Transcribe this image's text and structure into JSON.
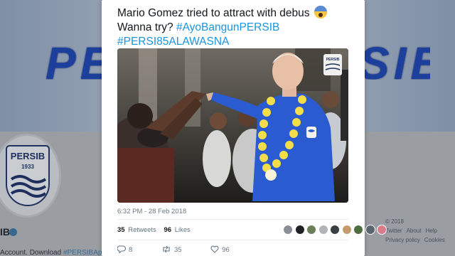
{
  "background": {
    "banner_word_left": "PERS",
    "banner_word_right": "SIB",
    "crest": {
      "name": "PERSIB",
      "year": "1933"
    },
    "profile_name_fragment": "IB",
    "bio_prefix": "Account. Download ",
    "bio_hashtag": "#PERSIBApps",
    "footer": {
      "copyright": "© 2018 Twitter",
      "about": "About",
      "help": "Help",
      "privacy": "Privacy policy",
      "cookies": "Cookies"
    }
  },
  "tweet": {
    "line1": "Mario Gomez tried to attract with debus",
    "emoji": "fearful-face-emoji",
    "line2_prefix": "Wanna try? ",
    "hashtag1": "#AyoBangunPERSIB",
    "hashtag2": "#PERSI85ALAWASNA",
    "photo": {
      "jersey_crest": "PERSIB",
      "description_icon": "photo"
    },
    "timestamp": "6:32 PM - 28 Feb 2018",
    "retweets_count": "35",
    "retweets_label": "Retweets",
    "likes_count": "96",
    "likes_label": "Likes",
    "liker_colors": [
      "#8a8f96",
      "#1e2226",
      "#6d7f5a",
      "#b0b4b8",
      "#3a3f44",
      "#c49a6c",
      "#4f6e3f",
      "#5a6570",
      "#d97b8a"
    ],
    "actions": {
      "reply_count": "8",
      "retweet_count": "35",
      "like_count": "96"
    }
  },
  "colors": {
    "hashtag": "#1b95e0",
    "text": "#14171a",
    "meta": "#657786",
    "jersey": "#2a5bd0"
  }
}
